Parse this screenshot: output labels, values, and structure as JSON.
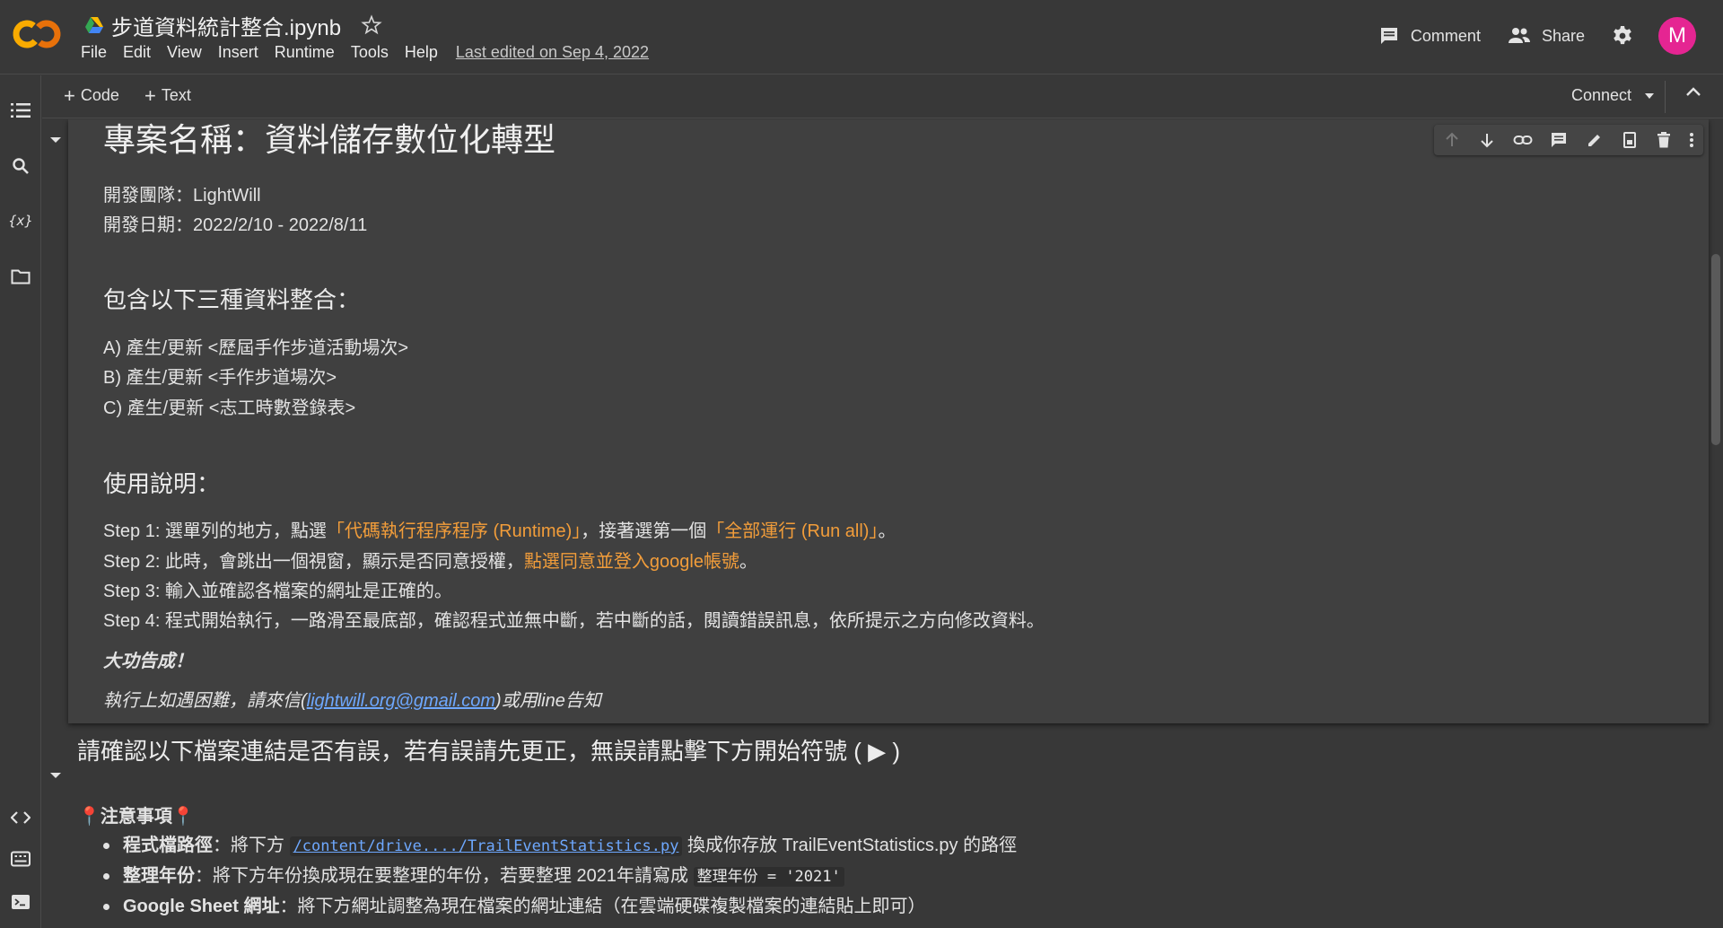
{
  "header": {
    "logo": "CO",
    "title": "步道資料統計整合.ipynb",
    "menu": [
      "File",
      "Edit",
      "View",
      "Insert",
      "Runtime",
      "Tools",
      "Help"
    ],
    "last_edited": "Last edited on Sep 4, 2022",
    "comment_label": "Comment",
    "share_label": "Share",
    "avatar_letter": "M",
    "avatar_color": "#e52592"
  },
  "toolbar": {
    "add_code": "Code",
    "add_text": "Text",
    "connect_label": "Connect"
  },
  "cell1": {
    "title": "專案名稱：資料儲存數位化轉型",
    "team": "開發團隊：LightWill",
    "date": "開發日期：2022/2/10 - 2022/8/11",
    "includes_heading": "包含以下三種資料整合：",
    "items": [
      "A) 產生/更新 <歷屆手作步道活動場次>",
      "B) 產生/更新 <手作步道場次>",
      "C) 產生/更新 <志工時數登錄表>"
    ],
    "usage_heading": "使用說明：",
    "step1": {
      "a": "Step 1: 選單列的地方，點選",
      "b": "「代碼執行程序程序 (Runtime)」",
      "c": "，接著選第一個",
      "d": "「全部運行 (Run all)」",
      "e": "。"
    },
    "step2": {
      "a": "Step 2: 此時，會跳出一個視窗，顯示是否同意授權，",
      "b": "點選同意並登入google帳號",
      "c": "。"
    },
    "step3": "Step 3: 輸入並確認各檔案的網址是正確的。",
    "step4": "Step 4: 程式開始執行，一路滑至最底部，確認程式並無中斷，若中斷的話，閱讀錯誤訊息，依所提示之方向修改資料。",
    "done": "大功告成！",
    "contact_pre": "執行上如遇困難，請來信(",
    "contact_email": "lightwill.org@gmail.com",
    "contact_post": ")或用line告知"
  },
  "cell2": {
    "heading": "請確認以下檔案連結是否有誤，若有誤請先更正，無誤請點擊下方開始符號 ( ▶ )",
    "notice": "📍注意事項📍",
    "b1": {
      "label": "程式檔路徑",
      "text1": "：將下方 ",
      "code": "/content/drive..../TrailEventStatistics.py",
      "text2": " 換成你存放 TrailEventStatistics.py 的路徑"
    },
    "b2": {
      "label": "整理年份",
      "text1": "：將下方年份換成現在要整理的年份，若要整理 2021年請寫成 ",
      "code": "整理年份 = '2021'"
    },
    "b3": {
      "label": "Google Sheet 網址",
      "text1": "：將下方網址調整為現在檔案的網址連結（在雲端硬碟複製檔案的連結貼上即可）"
    }
  },
  "colors": {
    "background": "#383838",
    "cell_background": "#404040",
    "highlight_orange": "#f29d3a",
    "link_blue": "#6ea8fe"
  }
}
